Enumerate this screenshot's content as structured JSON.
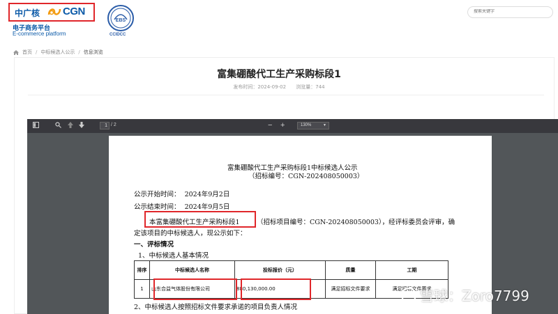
{
  "header": {
    "logo_cn": "中广核",
    "logo_en": "CGN",
    "platform_cn": "电子商务平台",
    "platform_en": "E-commerce platform",
    "ebs_badge": "EBS",
    "ebs_name": "CCIDCC",
    "search_placeholder": "搜索关键字"
  },
  "breadcrumb": {
    "home": "首页",
    "section": "中标候选人公示",
    "current": "信息浏览"
  },
  "article": {
    "title": "富集硼酸代工生产采购标段1",
    "publish_label": "发布时间：",
    "publish_date": "2024-09-02",
    "views_label": "浏览量：",
    "views": "744"
  },
  "pdf_toolbar": {
    "page_current": "1",
    "page_total": "/ 2",
    "zoom_out": "−",
    "zoom_in": "+",
    "zoom_value": "130%"
  },
  "pdf": {
    "heading_1": "富集硼酸代工生产采购标段1中标候选人公示",
    "heading_2": "（招标编号：CGN-202408050003）",
    "start_label": "公示开始时间：",
    "start_date": "2024年9月2日",
    "end_label": "公示结束时间：",
    "end_date": "2024年9月5日",
    "para_highlight": "本富集硼酸代工生产采购标段1",
    "para_rest": "（招标项目编号：CGN-202408050003），经评标委员会评审，确",
    "para_line2": "定该项目的中标候选人，现公示如下：",
    "section_1": "一、评标情况",
    "sub_1": "1、中标候选人基本情况",
    "table_headers": [
      "排序",
      "中标候选人名称",
      "投标报价（元）",
      "质量",
      "工期"
    ],
    "table_rows": [
      [
        "1",
        "山东合益气体股份有限公司",
        "880,130,000.00",
        "满足招标文件要求",
        "满足招标文件要求"
      ]
    ],
    "sub_2": "2、中标候选人按照招标文件要求承诺的项目负责人情况"
  },
  "watermark": {
    "text": "雪球：Zoro7799"
  },
  "colors": {
    "brand_blue": "#0b5aa8",
    "highlight_red": "#e0262a",
    "viewer_bg": "#525659",
    "toolbar_bg": "#38383d"
  }
}
